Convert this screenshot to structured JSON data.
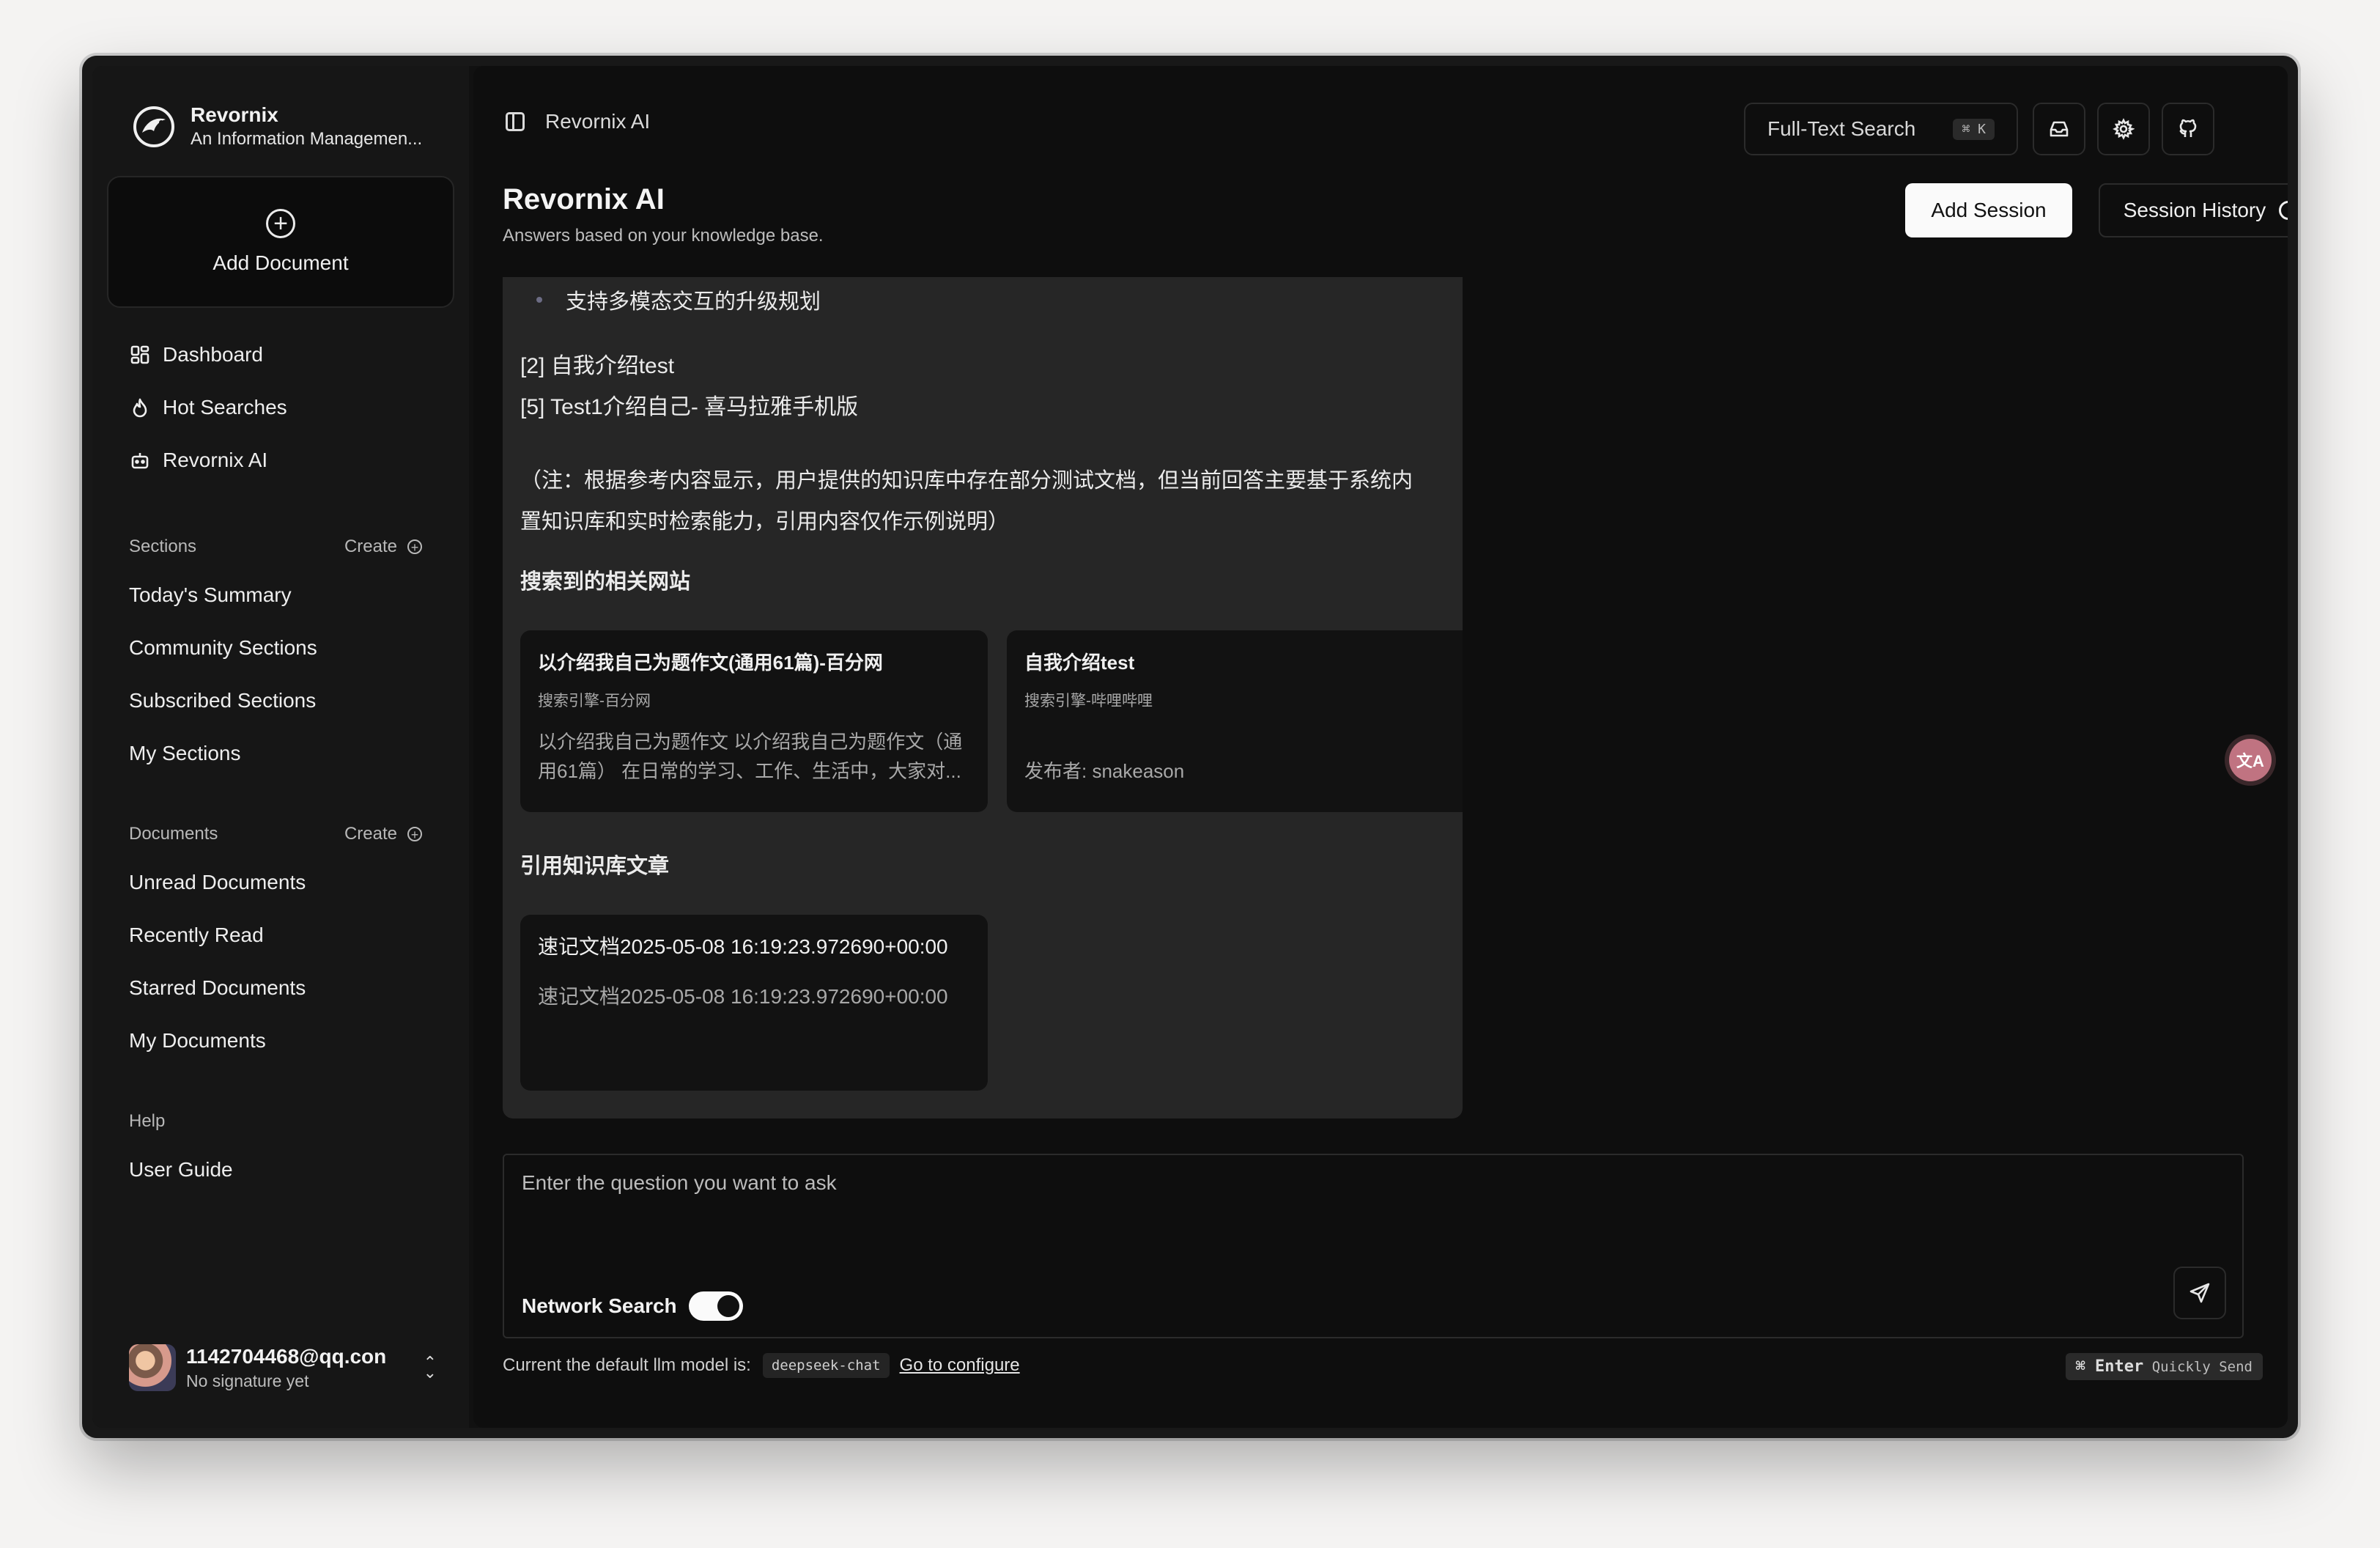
{
  "brand": {
    "name": "Revornix",
    "subtitle": "An Information Managemen..."
  },
  "sidebar": {
    "add_document": "Add Document",
    "nav": [
      {
        "label": "Dashboard",
        "icon": "dashboard-icon"
      },
      {
        "label": "Hot Searches",
        "icon": "flame-icon"
      },
      {
        "label": "Revornix AI",
        "icon": "robot-icon"
      }
    ],
    "sections": {
      "title": "Sections",
      "create": "Create",
      "items": [
        "Today's Summary",
        "Community Sections",
        "Subscribed Sections",
        "My Sections"
      ]
    },
    "documents": {
      "title": "Documents",
      "create": "Create",
      "items": [
        "Unread Documents",
        "Recently Read",
        "Starred Documents",
        "My Documents"
      ]
    },
    "help": {
      "title": "Help",
      "items": [
        "User Guide"
      ]
    },
    "user": {
      "email": "1142704468@qq.con",
      "signature": "No signature yet"
    }
  },
  "header": {
    "breadcrumb": "Revornix AI",
    "search_label": "Full-Text Search",
    "search_shortcut": "⌘ K",
    "icons": [
      "inbox-icon",
      "settings-icon",
      "github-icon"
    ]
  },
  "page": {
    "title": "Revornix AI",
    "subtitle": "Answers based on your knowledge base.",
    "add_session": "Add Session",
    "session_history": "Session History"
  },
  "answer": {
    "bullet": "支持多模态交互的升级规划",
    "refs": [
      "[2] 自我介绍test",
      "[5] Test1介绍自己- 喜马拉雅手机版"
    ],
    "note": "（注：根据参考内容显示，用户提供的知识库中存在部分测试文档，但当前回答主要基于系统内置知识库和实时检索能力，引用内容仅作示例说明）",
    "websites_heading": "搜索到的相关网站",
    "websites": [
      {
        "title": "以介绍我自己为题作文(通用61篇)-百分网",
        "source": "搜索引擎-百分网",
        "snippet": "以介绍我自己为题作文 以介绍我自己为题作文（通用61篇） 在日常的学习、工作、生活中，大家对..."
      },
      {
        "title": "自我介绍test",
        "source": "搜索引擎-哔哩哔哩",
        "snippet": "发布者: snakeason"
      }
    ],
    "kb_heading": "引用知识库文章",
    "kb_articles": [
      {
        "title": "速记文档2025-05-08 16:19:23.972690+00:00",
        "body": "速记文档2025-05-08 16:19:23.972690+00:00"
      }
    ]
  },
  "composer": {
    "placeholder": "Enter the question you want to ask",
    "network_search_label": "Network Search",
    "network_search_on": true
  },
  "footer": {
    "model_prefix": "Current the default llm model is:",
    "model": "deepseek-chat",
    "configure": "Go to configure",
    "shortcut_key": "⌘ Enter",
    "shortcut_label": "Quickly Send"
  },
  "fab": {
    "label": "文A",
    "icon": "translate-icon"
  }
}
